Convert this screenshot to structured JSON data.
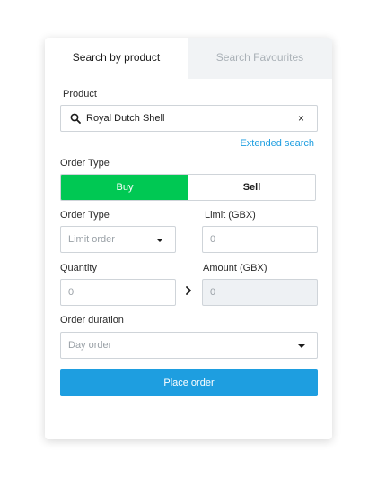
{
  "tabs": {
    "active": "Search by product",
    "inactive": "Search Favourites"
  },
  "product": {
    "label": "Product",
    "value": "Royal Dutch Shell",
    "clear": "×",
    "extended_search": "Extended search"
  },
  "order_side": {
    "label": "Order Type",
    "buy": "Buy",
    "sell": "Sell",
    "selected": "Buy"
  },
  "order_type": {
    "label": "Order Type",
    "value": "Limit order"
  },
  "limit": {
    "label": "Limit (GBX)",
    "value": "0"
  },
  "quantity": {
    "label": "Quantity",
    "value": "0"
  },
  "amount": {
    "label": "Amount (GBX)",
    "value": "0"
  },
  "duration": {
    "label": "Order duration",
    "value": "Day order"
  },
  "place_order": "Place order",
  "colors": {
    "buy_green": "#00c853",
    "accent_blue": "#1e9ee0",
    "inactive_tab_bg": "#f1f3f5"
  },
  "icons": [
    "search-icon",
    "close-icon",
    "chevron-down-icon",
    "chevron-right-icon"
  ]
}
